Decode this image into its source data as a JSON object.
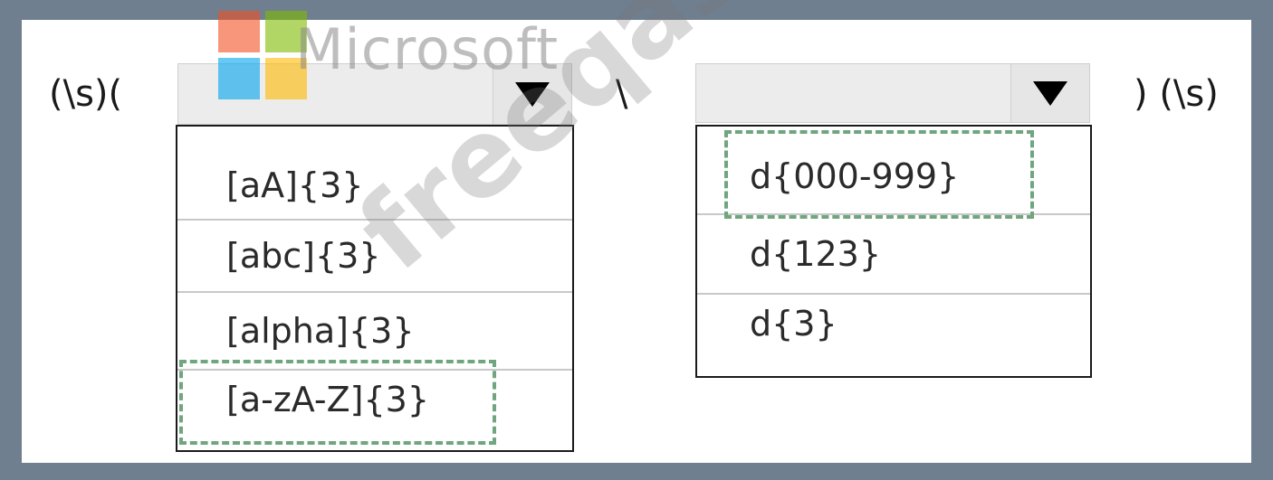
{
  "expression": {
    "prefix": "(\\s)(",
    "middle": "\\",
    "suffix": ") (\\s)"
  },
  "dropdown1": {
    "selected": "",
    "options": [
      "[aA]{3}",
      "[abc]{3}",
      "[alpha]{3}",
      "[a-zA-Z]{3}"
    ],
    "highlighted_option": "[a-zA-Z]{3}"
  },
  "dropdown2": {
    "selected": "",
    "options": [
      "d{000-999}",
      "d{123}",
      "d{3}"
    ],
    "highlighted_option": "d{000-999}"
  },
  "watermark": {
    "logo_text": "Microsoft",
    "site_text": "freeqas.com",
    "logo_colors": [
      "#f25022",
      "#7fba00",
      "#00a4ef",
      "#ffb900"
    ]
  },
  "colors": {
    "frame": "#6f7f8f",
    "highlight_dash": "#6fa67f"
  }
}
